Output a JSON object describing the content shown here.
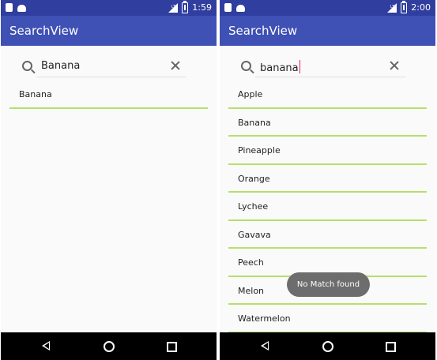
{
  "left": {
    "status_time": "1:59",
    "app_title": "SearchView",
    "search": {
      "query": "Banana"
    },
    "results": [
      "Banana"
    ]
  },
  "right": {
    "status_time": "2:00",
    "app_title": "SearchView",
    "search": {
      "query": "banana"
    },
    "results": [
      "Apple",
      "Banana",
      "Pineapple",
      "Orange",
      "Lychee",
      "Gavava",
      "Peech",
      "Melon",
      "Watermelon"
    ],
    "toast": "No Match found"
  },
  "icons": {
    "search": "search-icon",
    "clear": "close-icon",
    "back": "back-triangle-icon",
    "home": "home-circle-icon",
    "recents": "recents-square-icon"
  },
  "colors": {
    "toolbar": "#3F51B5",
    "statusbar": "#303F9F",
    "divider": "#b5e06b",
    "cursor": "#E91E63"
  }
}
